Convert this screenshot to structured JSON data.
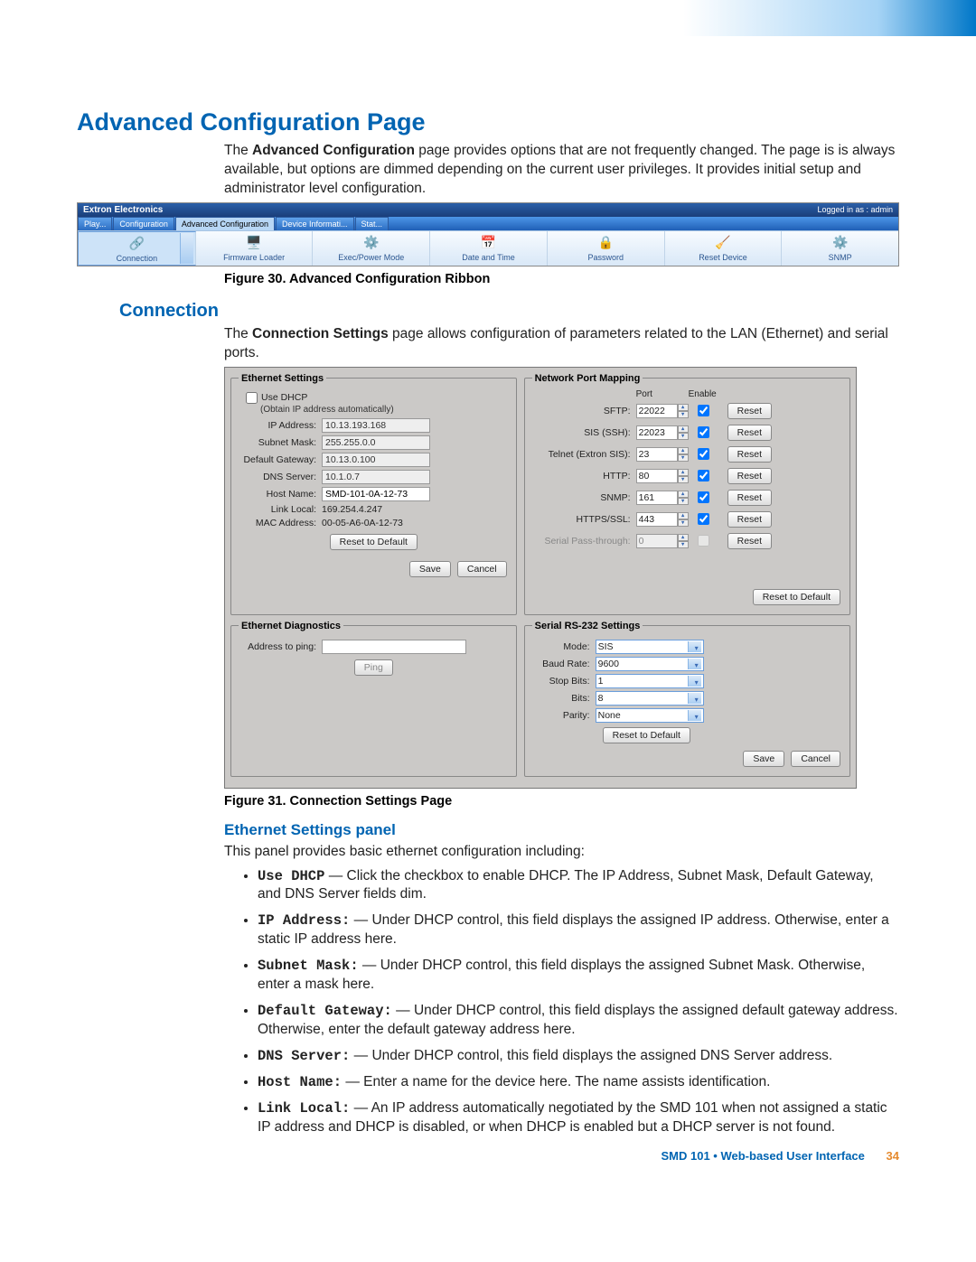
{
  "page_title": "Advanced Configuration Page",
  "intro": "The Advanced Configuration page provides options that are not frequently changed. The page is is always available, but options are dimmed depending on the current user privileges. It provides initial setup and administrator level configuration.",
  "ribbon": {
    "brand": "Extron Electronics",
    "login_status": "Logged in as : admin",
    "tabs": [
      "Play...",
      "Configuration",
      "Advanced Configuration",
      "Device Informati...",
      "Stat..."
    ],
    "active_tab": "Advanced Configuration",
    "items": [
      {
        "label": "Connection",
        "icon": "🔗"
      },
      {
        "label": "Firmware Loader",
        "icon": "🖥️"
      },
      {
        "label": "Exec/Power Mode",
        "icon": "⚙️"
      },
      {
        "label": "Date and Time",
        "icon": "📅"
      },
      {
        "label": "Password",
        "icon": "🔒"
      },
      {
        "label": "Reset Device",
        "icon": "🧹"
      },
      {
        "label": "SNMP",
        "icon": "⚙️"
      }
    ]
  },
  "caption30": "Figure 30.  Advanced Configuration Ribbon",
  "section_connection": "Connection",
  "connection_intro": "The Connection Settings page allows configuration of parameters related to the LAN (Ethernet) and serial ports.",
  "ethernet": {
    "legend": "Ethernet Settings",
    "use_dhcp_label": "Use DHCP",
    "use_dhcp_checked": false,
    "dhcp_note": "(Obtain IP address automatically)",
    "ip_label": "IP Address:",
    "ip": "10.13.193.168",
    "mask_label": "Subnet Mask:",
    "mask": "255.255.0.0",
    "gw_label": "Default Gateway:",
    "gw": "10.13.0.100",
    "dns_label": "DNS Server:",
    "dns": "10.1.0.7",
    "host_label": "Host Name:",
    "host": "SMD-101-0A-12-73",
    "link_label": "Link Local:",
    "link": "169.254.4.247",
    "mac_label": "MAC Address:",
    "mac": "00-05-A6-0A-12-73",
    "reset_btn": "Reset to Default",
    "save_btn": "Save",
    "cancel_btn": "Cancel"
  },
  "portmap": {
    "legend": "Network Port Mapping",
    "h_port": "Port",
    "h_enable": "Enable",
    "rows": [
      {
        "label": "SFTP:",
        "port": "22022",
        "enabled": true,
        "reset": "Reset"
      },
      {
        "label": "SIS (SSH):",
        "port": "22023",
        "enabled": true,
        "reset": "Reset"
      },
      {
        "label": "Telnet (Extron SIS):",
        "port": "23",
        "enabled": true,
        "reset": "Reset"
      },
      {
        "label": "HTTP:",
        "port": "80",
        "enabled": true,
        "reset": "Reset"
      },
      {
        "label": "SNMP:",
        "port": "161",
        "enabled": true,
        "reset": "Reset"
      },
      {
        "label": "HTTPS/SSL:",
        "port": "443",
        "enabled": true,
        "reset": "Reset"
      },
      {
        "label": "Serial Pass-through:",
        "port": "0",
        "enabled": false,
        "reset": "Reset",
        "dim": true
      }
    ],
    "reset_all": "Reset to Default"
  },
  "diag": {
    "legend": "Ethernet Diagnostics",
    "addr_label": "Address to ping:",
    "addr_value": "",
    "ping_btn": "Ping"
  },
  "rs232": {
    "legend": "Serial RS-232 Settings",
    "mode_label": "Mode:",
    "mode": "SIS",
    "baud_label": "Baud Rate:",
    "baud": "9600",
    "stop_label": "Stop Bits:",
    "stop": "1",
    "bits_label": "Bits:",
    "bits": "8",
    "parity_label": "Parity:",
    "parity": "None",
    "reset_btn": "Reset to Default",
    "save_btn": "Save",
    "cancel_btn": "Cancel"
  },
  "caption31": "Figure 31.  Connection Settings Page",
  "subsection_eth": "Ethernet Settings panel",
  "eth_intro": "This panel provides basic ethernet configuration including:",
  "bullets": [
    {
      "code": "Use DHCP",
      "text": " — Click the checkbox to enable DHCP. The IP Address, Subnet Mask, Default Gateway, and DNS Server fields dim."
    },
    {
      "code": "IP Address:",
      "text": " — Under DHCP control, this field displays the assigned IP address. Otherwise, enter a static IP address here."
    },
    {
      "code": "Subnet Mask:",
      "text": " — Under DHCP control, this field displays the assigned Subnet Mask. Otherwise, enter a mask here."
    },
    {
      "code": "Default Gateway:",
      "text": " — Under DHCP control, this field displays the assigned default gateway address. Otherwise, enter the default gateway address here."
    },
    {
      "code": "DNS Server:",
      "text": " — Under DHCP control, this field displays the assigned DNS Server address."
    },
    {
      "code": "Host Name:",
      "text": " — Enter a name for the device here. The name assists identification."
    },
    {
      "code": "Link Local:",
      "text": " — An IP address automatically negotiated by the SMD 101 when not assigned a static IP address and DHCP is disabled, or when DHCP is enabled but a DHCP server is not found."
    }
  ],
  "footer_text": "SMD 101 • Web-based User Interface",
  "page_number": "34"
}
